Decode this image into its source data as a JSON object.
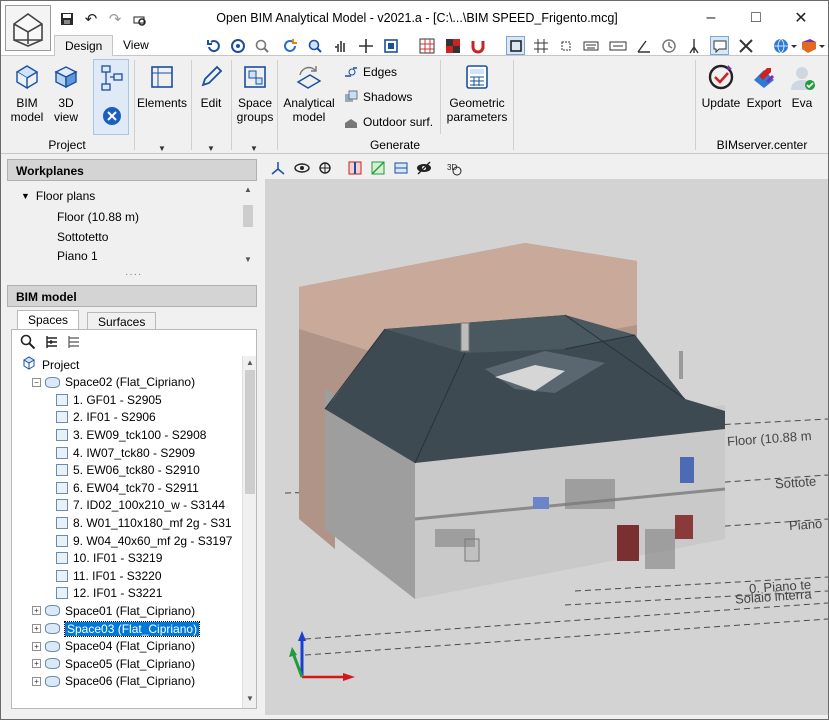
{
  "title_bar": {
    "title": "Open BIM Analytical Model - v2021.a - [C:\\...\\BIM SPEED_Frigento.mcg]",
    "minimize_label": "–",
    "maximize_label": "□",
    "close_label": "✕"
  },
  "tabs": [
    "Design",
    "View"
  ],
  "ribbon": {
    "project_group": {
      "label": "Project",
      "bim_model": "BIM model",
      "view_3d": "3D view"
    },
    "elements": "Elements",
    "edit": "Edit",
    "space_groups": "Space groups",
    "generate_group": {
      "label": "Generate",
      "analytical_model": "Analytical model",
      "edges": "Edges",
      "shadows": "Shadows",
      "outdoor_surf": "Outdoor surf."
    },
    "geometric_parameters": "Geometric parameters",
    "bimserver_group": {
      "label": "BIMserver.center",
      "update": "Update",
      "export": "Export",
      "user": "Eva"
    }
  },
  "workplanes": {
    "header": "Workplanes",
    "group": "Floor plans",
    "items": [
      "Floor (10.88 m)",
      "Sottotetto",
      "Piano 1"
    ]
  },
  "bim_model": {
    "header": "BIM model",
    "subtabs": [
      "Spaces",
      "Surfaces"
    ],
    "root": "Project",
    "expanded_space": "Space02 (Flat_Cipriano)",
    "surfaces": [
      "1. GF01 - S2905",
      "2. IF01 - S2906",
      "3. EW09_tck100 - S2908",
      "4. IW07_tck80 - S2909",
      "5. EW06_tck80 - S2910",
      "6. EW04_tck70 - S2911",
      "7. ID02_100x210_w - S3144",
      "8. W01_110x180_mf 2g - S31",
      "9. W04_40x60_mf 2g - S3197",
      "10. IF01 - S3219",
      "11. IF01 - S3220",
      "12. IF01 - S3221"
    ],
    "other_spaces": [
      "Space01 (Flat_Cipriano)",
      "Space03 (Flat_Cipriano)",
      "Space04 (Flat_Cipriano)",
      "Space05 (Flat_Cipriano)",
      "Space06 (Flat_Cipriano)"
    ],
    "selected_space": "Space03 (Flat_Cipriano)"
  },
  "viewport": {
    "plane_labels": [
      "Floor (10.88 m",
      "Sottote",
      "Piano",
      "0. Piano te",
      "Solaio interra"
    ]
  },
  "colors": {
    "selection": "#0078d7",
    "roof": "#3d4a52",
    "wall": "#c9c9c9",
    "annex": "#c9a99a",
    "viewport_bg": "#d3d3d3"
  }
}
